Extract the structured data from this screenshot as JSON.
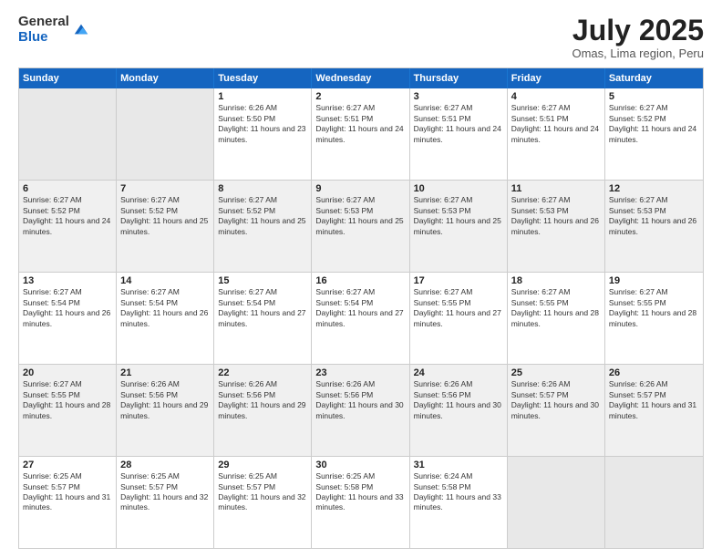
{
  "logo": {
    "general": "General",
    "blue": "Blue"
  },
  "title": "July 2025",
  "location": "Omas, Lima region, Peru",
  "days_of_week": [
    "Sunday",
    "Monday",
    "Tuesday",
    "Wednesday",
    "Thursday",
    "Friday",
    "Saturday"
  ],
  "weeks": [
    [
      {
        "day": "",
        "empty": true
      },
      {
        "day": "",
        "empty": true
      },
      {
        "day": "1",
        "sunrise": "Sunrise: 6:26 AM",
        "sunset": "Sunset: 5:50 PM",
        "daylight": "Daylight: 11 hours and 23 minutes."
      },
      {
        "day": "2",
        "sunrise": "Sunrise: 6:27 AM",
        "sunset": "Sunset: 5:51 PM",
        "daylight": "Daylight: 11 hours and 24 minutes."
      },
      {
        "day": "3",
        "sunrise": "Sunrise: 6:27 AM",
        "sunset": "Sunset: 5:51 PM",
        "daylight": "Daylight: 11 hours and 24 minutes."
      },
      {
        "day": "4",
        "sunrise": "Sunrise: 6:27 AM",
        "sunset": "Sunset: 5:51 PM",
        "daylight": "Daylight: 11 hours and 24 minutes."
      },
      {
        "day": "5",
        "sunrise": "Sunrise: 6:27 AM",
        "sunset": "Sunset: 5:52 PM",
        "daylight": "Daylight: 11 hours and 24 minutes."
      }
    ],
    [
      {
        "day": "6",
        "sunrise": "Sunrise: 6:27 AM",
        "sunset": "Sunset: 5:52 PM",
        "daylight": "Daylight: 11 hours and 24 minutes."
      },
      {
        "day": "7",
        "sunrise": "Sunrise: 6:27 AM",
        "sunset": "Sunset: 5:52 PM",
        "daylight": "Daylight: 11 hours and 25 minutes."
      },
      {
        "day": "8",
        "sunrise": "Sunrise: 6:27 AM",
        "sunset": "Sunset: 5:52 PM",
        "daylight": "Daylight: 11 hours and 25 minutes."
      },
      {
        "day": "9",
        "sunrise": "Sunrise: 6:27 AM",
        "sunset": "Sunset: 5:53 PM",
        "daylight": "Daylight: 11 hours and 25 minutes."
      },
      {
        "day": "10",
        "sunrise": "Sunrise: 6:27 AM",
        "sunset": "Sunset: 5:53 PM",
        "daylight": "Daylight: 11 hours and 25 minutes."
      },
      {
        "day": "11",
        "sunrise": "Sunrise: 6:27 AM",
        "sunset": "Sunset: 5:53 PM",
        "daylight": "Daylight: 11 hours and 26 minutes."
      },
      {
        "day": "12",
        "sunrise": "Sunrise: 6:27 AM",
        "sunset": "Sunset: 5:53 PM",
        "daylight": "Daylight: 11 hours and 26 minutes."
      }
    ],
    [
      {
        "day": "13",
        "sunrise": "Sunrise: 6:27 AM",
        "sunset": "Sunset: 5:54 PM",
        "daylight": "Daylight: 11 hours and 26 minutes."
      },
      {
        "day": "14",
        "sunrise": "Sunrise: 6:27 AM",
        "sunset": "Sunset: 5:54 PM",
        "daylight": "Daylight: 11 hours and 26 minutes."
      },
      {
        "day": "15",
        "sunrise": "Sunrise: 6:27 AM",
        "sunset": "Sunset: 5:54 PM",
        "daylight": "Daylight: 11 hours and 27 minutes."
      },
      {
        "day": "16",
        "sunrise": "Sunrise: 6:27 AM",
        "sunset": "Sunset: 5:54 PM",
        "daylight": "Daylight: 11 hours and 27 minutes."
      },
      {
        "day": "17",
        "sunrise": "Sunrise: 6:27 AM",
        "sunset": "Sunset: 5:55 PM",
        "daylight": "Daylight: 11 hours and 27 minutes."
      },
      {
        "day": "18",
        "sunrise": "Sunrise: 6:27 AM",
        "sunset": "Sunset: 5:55 PM",
        "daylight": "Daylight: 11 hours and 28 minutes."
      },
      {
        "day": "19",
        "sunrise": "Sunrise: 6:27 AM",
        "sunset": "Sunset: 5:55 PM",
        "daylight": "Daylight: 11 hours and 28 minutes."
      }
    ],
    [
      {
        "day": "20",
        "sunrise": "Sunrise: 6:27 AM",
        "sunset": "Sunset: 5:55 PM",
        "daylight": "Daylight: 11 hours and 28 minutes."
      },
      {
        "day": "21",
        "sunrise": "Sunrise: 6:26 AM",
        "sunset": "Sunset: 5:56 PM",
        "daylight": "Daylight: 11 hours and 29 minutes."
      },
      {
        "day": "22",
        "sunrise": "Sunrise: 6:26 AM",
        "sunset": "Sunset: 5:56 PM",
        "daylight": "Daylight: 11 hours and 29 minutes."
      },
      {
        "day": "23",
        "sunrise": "Sunrise: 6:26 AM",
        "sunset": "Sunset: 5:56 PM",
        "daylight": "Daylight: 11 hours and 30 minutes."
      },
      {
        "day": "24",
        "sunrise": "Sunrise: 6:26 AM",
        "sunset": "Sunset: 5:56 PM",
        "daylight": "Daylight: 11 hours and 30 minutes."
      },
      {
        "day": "25",
        "sunrise": "Sunrise: 6:26 AM",
        "sunset": "Sunset: 5:57 PM",
        "daylight": "Daylight: 11 hours and 30 minutes."
      },
      {
        "day": "26",
        "sunrise": "Sunrise: 6:26 AM",
        "sunset": "Sunset: 5:57 PM",
        "daylight": "Daylight: 11 hours and 31 minutes."
      }
    ],
    [
      {
        "day": "27",
        "sunrise": "Sunrise: 6:25 AM",
        "sunset": "Sunset: 5:57 PM",
        "daylight": "Daylight: 11 hours and 31 minutes."
      },
      {
        "day": "28",
        "sunrise": "Sunrise: 6:25 AM",
        "sunset": "Sunset: 5:57 PM",
        "daylight": "Daylight: 11 hours and 32 minutes."
      },
      {
        "day": "29",
        "sunrise": "Sunrise: 6:25 AM",
        "sunset": "Sunset: 5:57 PM",
        "daylight": "Daylight: 11 hours and 32 minutes."
      },
      {
        "day": "30",
        "sunrise": "Sunrise: 6:25 AM",
        "sunset": "Sunset: 5:58 PM",
        "daylight": "Daylight: 11 hours and 33 minutes."
      },
      {
        "day": "31",
        "sunrise": "Sunrise: 6:24 AM",
        "sunset": "Sunset: 5:58 PM",
        "daylight": "Daylight: 11 hours and 33 minutes."
      },
      {
        "day": "",
        "empty": true
      },
      {
        "day": "",
        "empty": true
      }
    ]
  ]
}
